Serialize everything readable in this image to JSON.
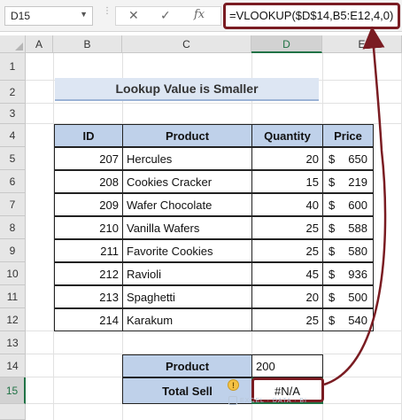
{
  "name_box": "D15",
  "formula_bar": {
    "cancel_icon": "✕",
    "enter_icon": "✓",
    "fx_label": "fx",
    "formula": "=VLOOKUP($D$14,B5:E12,4,0)"
  },
  "columns": [
    "A",
    "B",
    "C",
    "D",
    "E"
  ],
  "rows": [
    "1",
    "2",
    "3",
    "4",
    "5",
    "6",
    "7",
    "8",
    "9",
    "10",
    "11",
    "12",
    "13",
    "14",
    "15"
  ],
  "sheet_title": "Lookup Value is Smaller",
  "table": {
    "headers": [
      "ID",
      "Product",
      "Quantity",
      "Price"
    ],
    "rows": [
      {
        "id": "207",
        "product": "Hercules",
        "qty": "20",
        "cur": "$",
        "price": "650"
      },
      {
        "id": "208",
        "product": "Cookies Cracker",
        "qty": "15",
        "cur": "$",
        "price": "219"
      },
      {
        "id": "209",
        "product": "Wafer Chocolate",
        "qty": "40",
        "cur": "$",
        "price": "600"
      },
      {
        "id": "210",
        "product": "Vanilla Wafers",
        "qty": "25",
        "cur": "$",
        "price": "588"
      },
      {
        "id": "211",
        "product": "Favorite Cookies",
        "qty": "25",
        "cur": "$",
        "price": "580"
      },
      {
        "id": "212",
        "product": "Ravioli",
        "qty": "45",
        "cur": "$",
        "price": "936"
      },
      {
        "id": "213",
        "product": "Spaghetti",
        "qty": "20",
        "cur": "$",
        "price": "500"
      },
      {
        "id": "214",
        "product": "Karakum",
        "qty": "25",
        "cur": "$",
        "price": "540"
      }
    ]
  },
  "lookup": {
    "product_label": "Product",
    "product_value": "200",
    "total_label": "Total Sell",
    "total_value": "#N/A",
    "error_icon": "!"
  },
  "watermark": "EXCEL · DATA · BI",
  "colors": {
    "accent": "#7a1c22",
    "header_fill": "#bfd1ea",
    "title_fill": "#dde6f3",
    "excel_green": "#217346"
  }
}
